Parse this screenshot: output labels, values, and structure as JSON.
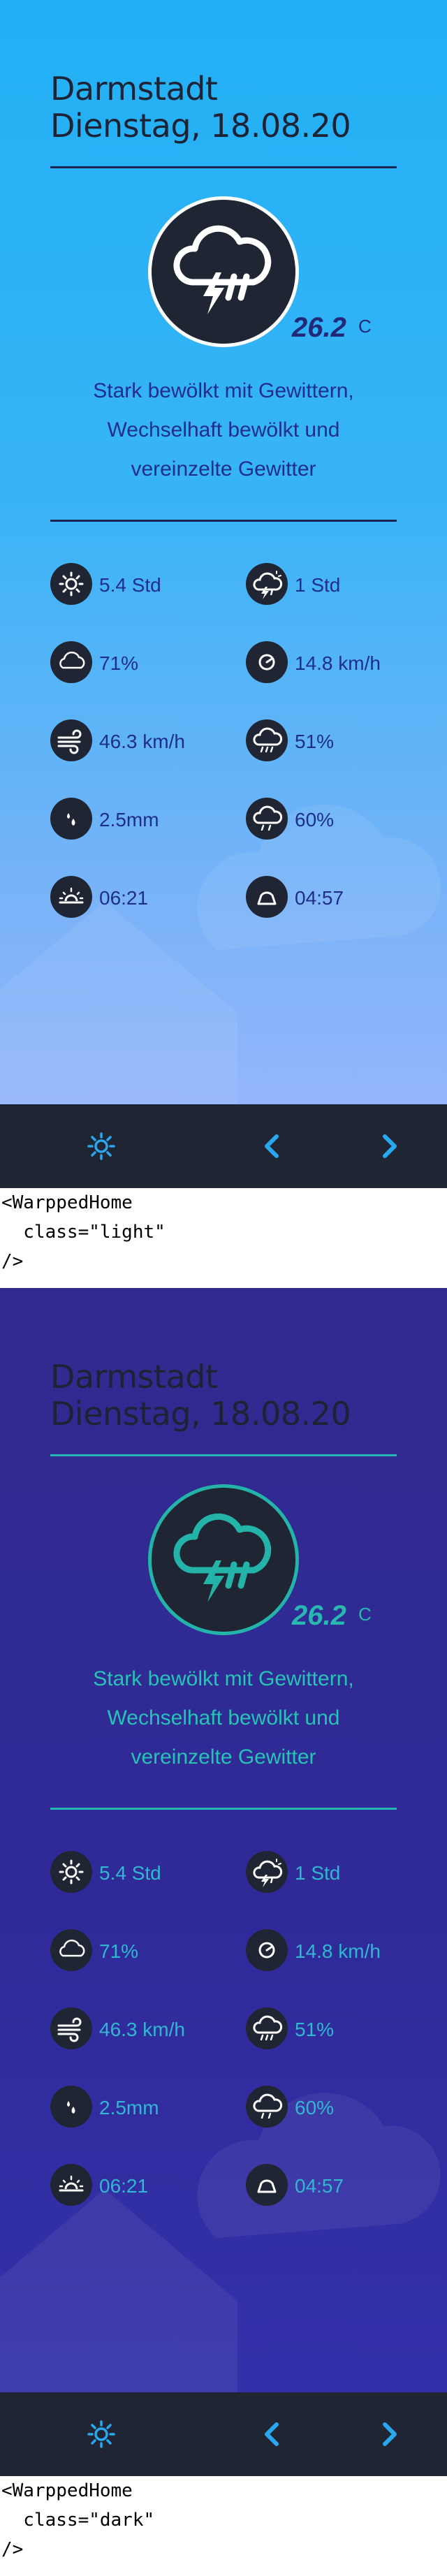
{
  "screens": {
    "light": {
      "city": "Darmstadt",
      "date": "Dienstag, 18.08.20",
      "temperature": "26.2",
      "temperature_unit": "C",
      "description_lines": [
        "Stark bewölkt mit Gewittern,",
        "Wechselhaft bewölkt und",
        "vereinzelte Gewitter"
      ],
      "stats": {
        "sunshine": "5.4 Std",
        "thunder": "1 Std",
        "cloud_cover": "71%",
        "wind_gust": "14.8 km/h",
        "wind": "46.3 km/h",
        "rain_probability": "51%",
        "precipitation": "2.5mm",
        "humidity": "60%",
        "sunrise": "06:21",
        "sunset": "04:57"
      },
      "code_lines": [
        "<WarppedHome",
        "  class=\"light\"",
        "/>"
      ]
    },
    "dark": {
      "city": "Darmstadt",
      "date": "Dienstag, 18.08.20",
      "temperature": "26.2",
      "temperature_unit": "C",
      "description_lines": [
        "Stark bewölkt mit Gewittern,",
        "Wechselhaft bewölkt und",
        "vereinzelte Gewitter"
      ],
      "stats": {
        "sunshine": "5.4 Std",
        "thunder": "1 Std",
        "cloud_cover": "71%",
        "wind_gust": "14.8 km/h",
        "wind": "46.3 km/h",
        "rain_probability": "51%",
        "precipitation": "2.5mm",
        "humidity": "60%",
        "sunrise": "06:21",
        "sunset": "04:57"
      },
      "code_lines": [
        "<WarppedHome",
        "  class=\"dark\"",
        "/>"
      ]
    }
  },
  "icons": {
    "weather": "cloud-thunder-rain-icon",
    "sunshine": "sun-icon",
    "thunder": "cloud-sun-lightning-icon",
    "cloud_cover": "cloud-icon",
    "wind_gust": "gauge-icon",
    "wind": "wind-icon",
    "rain_probability": "cloud-rain-icon",
    "precipitation": "raindrops-icon",
    "humidity": "cloud-percent-icon",
    "sunrise": "sunrise-icon",
    "sunset": "sunset-icon",
    "nav_settings": "gear-sun-icon",
    "nav_previous": "chevron-left-icon",
    "nav_next": "chevron-right-icon"
  },
  "colors": {
    "light_bg_top": "#21b0f5",
    "light_bg_bottom": "#94b5fb",
    "dark_bg": "#2f2a98",
    "navbar": "#1f2533",
    "nav_accent": "#29a8f0",
    "dark_accent": "#27b7b2"
  }
}
